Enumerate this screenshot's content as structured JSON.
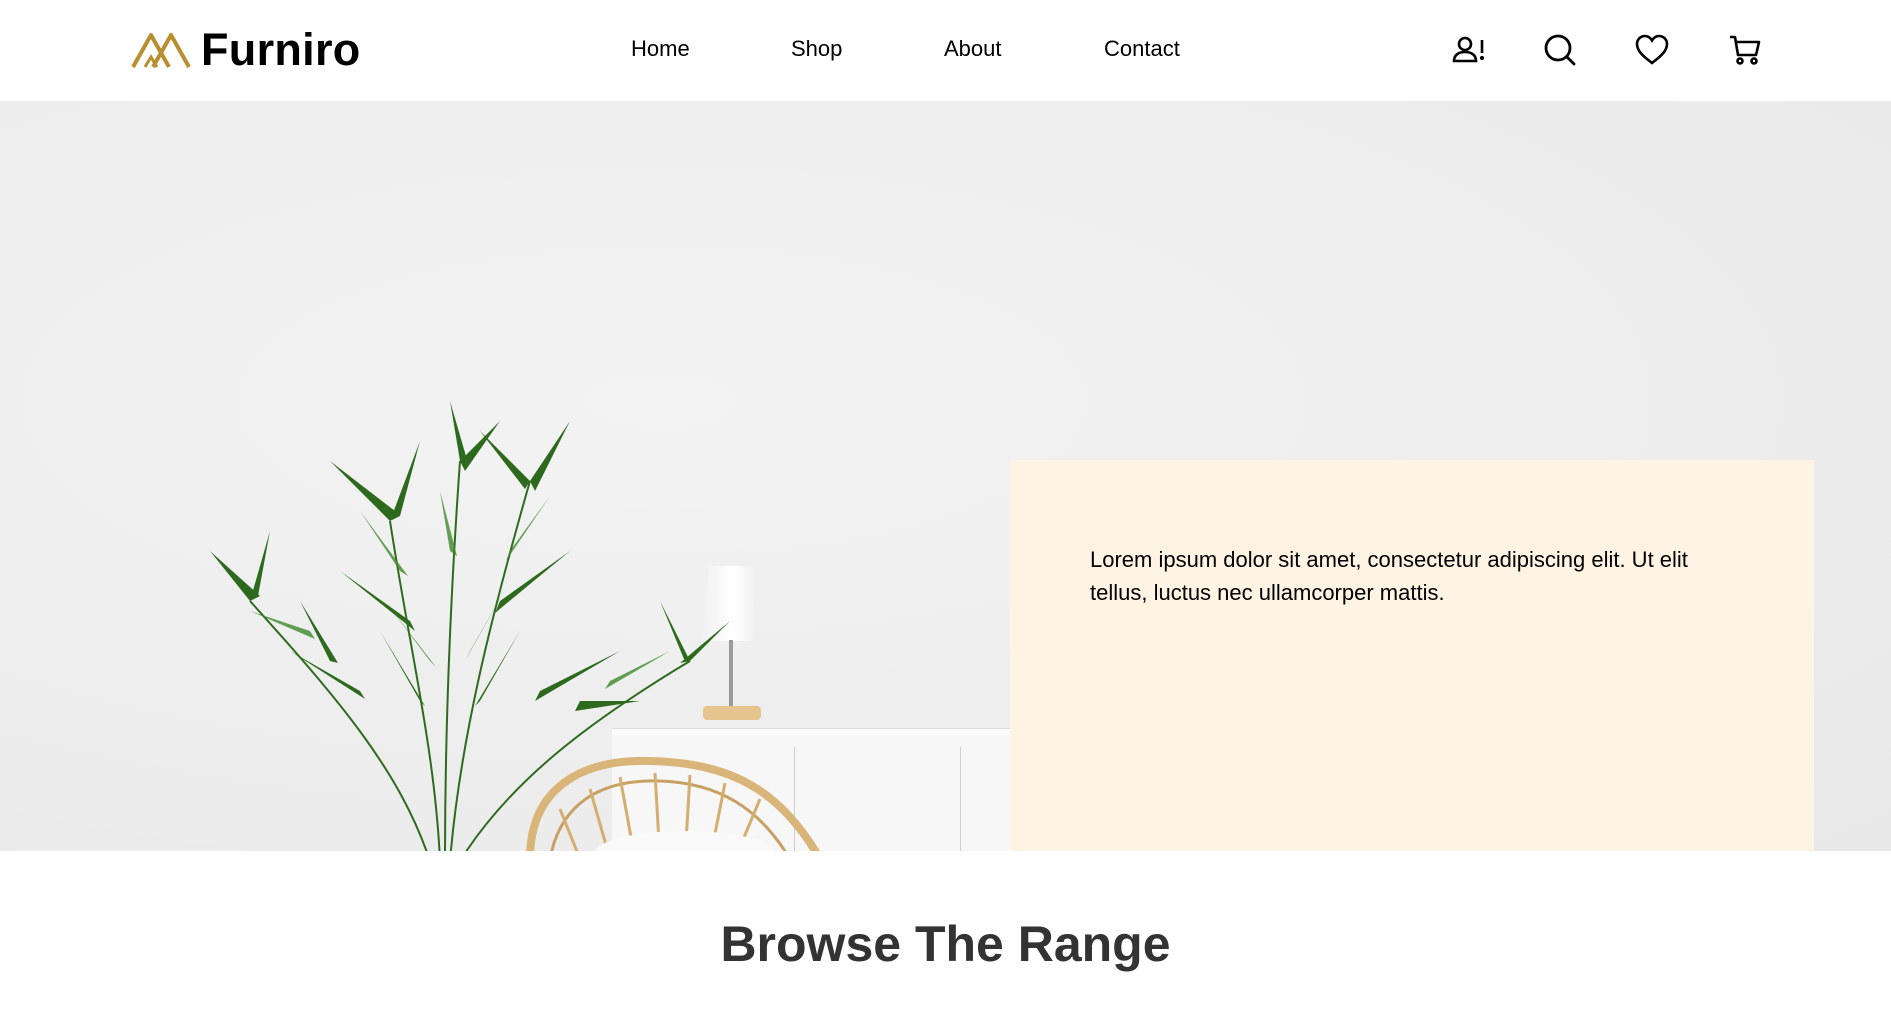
{
  "header": {
    "brand": "Furniro",
    "nav": [
      "Home",
      "Shop",
      "About",
      "Contact"
    ],
    "icons": [
      "account-alert-icon",
      "search-icon",
      "heart-icon",
      "cart-icon"
    ]
  },
  "hero": {
    "card_text": "Lorem ipsum dolor sit amet, consectetur adipiscing elit. Ut elit tellus, luctus nec ullamcorper mattis."
  },
  "section": {
    "title": "Browse The Range"
  },
  "colors": {
    "brand_gold": "#B88E2F",
    "card_bg": "#FFF3E3",
    "title_text": "#333333"
  }
}
